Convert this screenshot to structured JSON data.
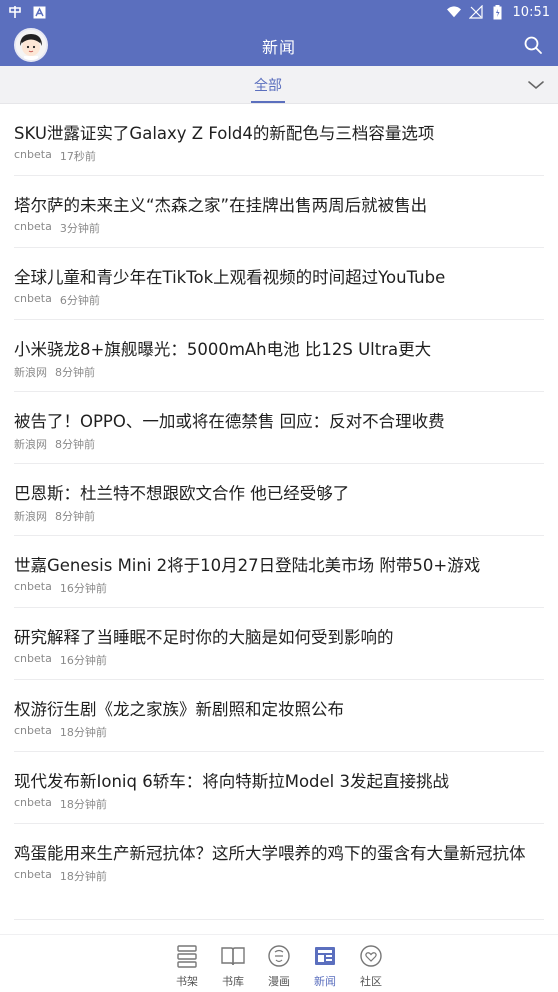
{
  "status_bar": {
    "time": "10:51",
    "icons": [
      "app-notification-icon",
      "a-notification-icon",
      "wifi-icon",
      "no-signal-icon",
      "battery-charging-icon"
    ]
  },
  "header": {
    "title": "新闻",
    "avatar": "user-avatar",
    "search_icon": "search-icon"
  },
  "tabs": {
    "active_label": "全部",
    "expand_icon": "chevron-down-icon"
  },
  "news": [
    {
      "title": "SKU泄露证实了Galaxy Z Fold4的新配色与三档容量选项",
      "source": "cnbeta",
      "time": "17秒前"
    },
    {
      "title": "塔尔萨的未来主义“杰森之家”在挂牌出售两周后就被售出",
      "source": "cnbeta",
      "time": "3分钟前"
    },
    {
      "title": "全球儿童和青少年在TikTok上观看视频的时间超过YouTube",
      "source": "cnbeta",
      "time": "6分钟前"
    },
    {
      "title": "小米骁龙8+旗舰曝光：5000mAh电池 比12S Ultra更大",
      "source": "新浪网",
      "time": "8分钟前"
    },
    {
      "title": "被告了！OPPO、一加或将在德禁售 回应：反对不合理收费",
      "source": "新浪网",
      "time": "8分钟前"
    },
    {
      "title": "巴恩斯：杜兰特不想跟欧文合作 他已经受够了",
      "source": "新浪网",
      "time": "8分钟前"
    },
    {
      "title": "世嘉Genesis Mini 2将于10月27日登陆北美市场 附带50+游戏",
      "source": "cnbeta",
      "time": "16分钟前"
    },
    {
      "title": "研究解释了当睡眠不足时你的大脑是如何受到影响的",
      "source": "cnbeta",
      "time": "16分钟前"
    },
    {
      "title": "权游衍生剧《龙之家族》新剧照和定妆照公布",
      "source": "cnbeta",
      "time": "18分钟前"
    },
    {
      "title": "现代发布新Ioniq 6轿车：将向特斯拉Model 3发起直接挑战",
      "source": "cnbeta",
      "time": "18分钟前"
    },
    {
      "title": "鸡蛋能用来生产新冠抗体？这所大学喂养的鸡下的蛋含有大量新冠抗体",
      "source": "cnbeta",
      "time": "18分钟前"
    }
  ],
  "bottom_nav": [
    {
      "label": "书架",
      "icon": "bookshelf-icon"
    },
    {
      "label": "书库",
      "icon": "open-book-icon"
    },
    {
      "label": "漫画",
      "icon": "comic-icon"
    },
    {
      "label": "新闻",
      "icon": "newspaper-icon",
      "active": true
    },
    {
      "label": "社区",
      "icon": "community-heart-icon"
    }
  ],
  "colors": {
    "primary": "#5b6fbe",
    "tab_strip_bg": "#f2f2f4",
    "meta_text": "#8a8a8a"
  }
}
